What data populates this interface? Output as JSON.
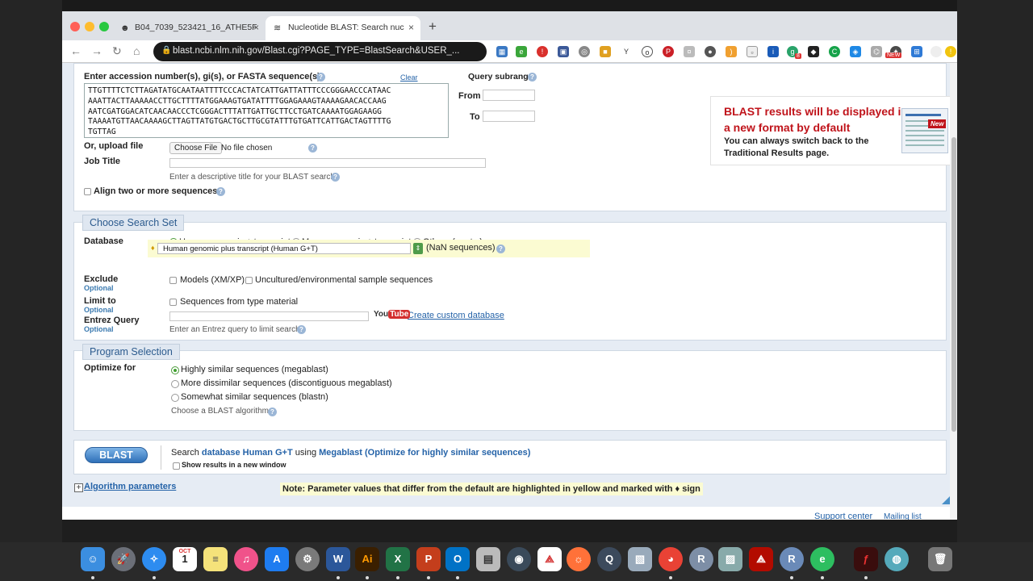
{
  "browser": {
    "tabs": [
      {
        "title": "B04_7039_523421_16_ATHE5F",
        "icon": "person-icon"
      },
      {
        "title": "Nucleotide BLAST: Search nuc",
        "icon": "blast-icon"
      }
    ],
    "url": "blast.ncbi.nlm.nih.gov/Blast.cgi?PAGE_TYPE=BlastSearch&USER_...",
    "new_tab_symbol": "+",
    "extension_badge_count": "8",
    "extension_badge_new": "NEW"
  },
  "query": {
    "label": "Enter accession number(s), gi(s), or FASTA sequence(s)",
    "clear": "Clear",
    "sequence": "TTGTTTTCTCTTAGATATGCAATAATTTTCCCACTATCATTGATTATTTCCCGGGAACCCATAAC\nAAATTACTTAAAAACCTTGCTTTTATGGAAAGTGATATTTTGGAGAAAGTAAAAGAACACCAAG\nAATCGATGGACATCAACAACCCTCGGGACTTTATTGATTGCTTCCTGATCAAAATGGAGAAGG\nTAAAATGTTAACAAAAGCTTAGTTATGTGACTGCTTGCGTATTTGTGATTCATTGACTAGTTTTG\nTGTTAG",
    "subrange_label": "Query subrange",
    "from_label": "From",
    "to_label": "To",
    "upload_label": "Or, upload file",
    "choose_file": "Choose File",
    "no_file": "No file chosen",
    "job_title_label": "Job Title",
    "job_title_hint": "Enter a descriptive title for your BLAST search",
    "align_two": "Align two or more sequences"
  },
  "promo": {
    "title": "BLAST results will be displayed in a new format by default",
    "subtitle": "You can always switch back to the Traditional Results page.",
    "badge": "New"
  },
  "search_set": {
    "legend": "Choose Search Set",
    "database_label": "Database",
    "db_options": [
      "Human genomic + transcript",
      "Mouse genomic + transcript",
      "Others (nr etc.):"
    ],
    "db_selected": "Human genomic plus transcript (Human G+T)",
    "db_count": "(NaN sequences)",
    "exclude_label": "Exclude",
    "optional": "Optional",
    "exclude_models": "Models (XM/XP)",
    "exclude_uncultured": "Uncultured/environmental sample sequences",
    "limit_label": "Limit to",
    "limit_type": "Sequences from type material",
    "entrez_label": "Entrez Query",
    "entrez_hint": "Enter an Entrez query to limit search",
    "youtube_you": "You",
    "youtube_tube": "Tube",
    "custom_db": "Create custom database"
  },
  "program": {
    "legend": "Program Selection",
    "optimize_label": "Optimize for",
    "options": [
      "Highly similar sequences (megablast)",
      "More dissimilar sequences (discontiguous megablast)",
      "Somewhat similar sequences (blastn)"
    ],
    "algo_hint": "Choose a BLAST algorithm"
  },
  "submit": {
    "button": "BLAST",
    "search_prefix": "Search ",
    "database_link": "database Human G+T",
    "using": " using ",
    "program_link": "Megablast (Optimize for highly similar sequences)",
    "new_window": "Show results in a new window"
  },
  "footer": {
    "algorithm_params": "Algorithm parameters",
    "note": "Note: Parameter values that differ from the default are highlighted in yellow and marked with ♦ sign",
    "support": "Support center",
    "mailing": "Mailing list"
  },
  "colors": {
    "accent": "#2563a8",
    "highlight": "#fbfbd2",
    "promo_red": "#c0141b"
  },
  "dock": [
    "Finder",
    "Launchpad",
    "Safari",
    "Calendar",
    "Notes",
    "Music",
    "App Store",
    "System Preferences",
    "Word",
    "Illustrator",
    "Excel",
    "PowerPoint",
    "Outlook",
    "Numbers",
    "Capture",
    "Acrobat",
    "Firefox",
    "QuickTime",
    "Preview",
    "Chrome",
    "R",
    "Photos",
    "Acrobat Pro",
    "RStudio",
    "Evernote",
    "Flash",
    "Disk Utility",
    "Trash"
  ],
  "calendar_day": "1",
  "calendar_month": "OCT"
}
